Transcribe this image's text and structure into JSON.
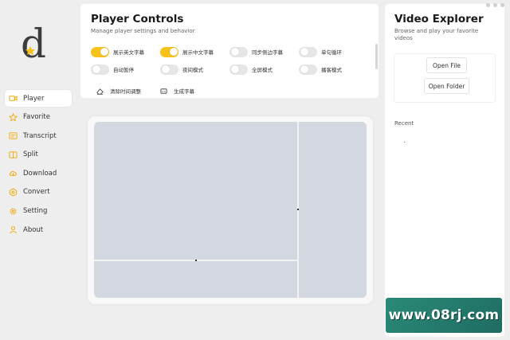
{
  "sidebar": {
    "logo_letter": "d",
    "items": [
      {
        "label": "Player",
        "icon": "video-icon",
        "active": true
      },
      {
        "label": "Favorite",
        "icon": "star-icon",
        "active": false
      },
      {
        "label": "Transcript",
        "icon": "transcript-icon",
        "active": false
      },
      {
        "label": "Split",
        "icon": "split-icon",
        "active": false
      },
      {
        "label": "Download",
        "icon": "cloud-download-icon",
        "active": false
      },
      {
        "label": "Convert",
        "icon": "convert-icon",
        "active": false
      },
      {
        "label": "Setting",
        "icon": "gear-icon",
        "active": false
      },
      {
        "label": "About",
        "icon": "person-icon",
        "active": false
      }
    ]
  },
  "controls": {
    "title": "Player Controls",
    "subtitle": "Manage player settings and behavior",
    "toggles": [
      {
        "label": "展示英文字幕",
        "on": true
      },
      {
        "label": "展示中文字幕",
        "on": true
      },
      {
        "label": "同步侧边字幕",
        "on": false
      },
      {
        "label": "单句循环",
        "on": false
      },
      {
        "label": "自动暂停",
        "on": false
      },
      {
        "label": "夜间模式",
        "on": false
      },
      {
        "label": "全屏模式",
        "on": false
      },
      {
        "label": "播客模式",
        "on": false
      }
    ],
    "actions": [
      {
        "label": "清除时间调整",
        "icon": "eraser-icon"
      },
      {
        "label": "生成字幕",
        "icon": "subtitle-icon"
      }
    ]
  },
  "explorer": {
    "title": "Video Explorer",
    "subtitle": "Browse and play your favorite videos",
    "open_file": "Open File",
    "open_folder": "Open Folder",
    "recent_label": "Recent"
  },
  "watermark": "www.08rj.com",
  "colors": {
    "accent": "#f7c21a",
    "background": "#eeeeee",
    "player_placeholder": "#d3d7df"
  }
}
